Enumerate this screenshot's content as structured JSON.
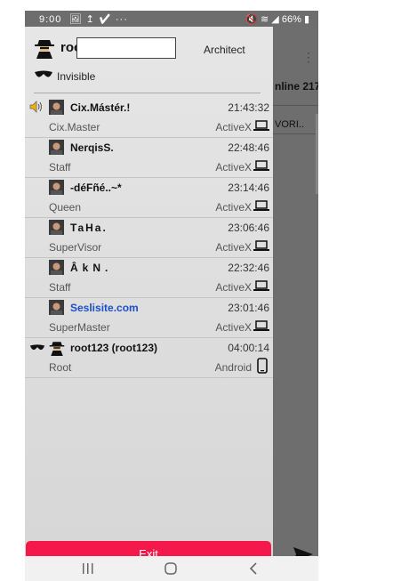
{
  "status_bar": {
    "time": "9:00",
    "left_icons": "🖼 ↥ ✔ ···",
    "right_icons": "🔇 ≋ ◢",
    "battery": "66%"
  },
  "header": {
    "username": "roo",
    "role": "Architect",
    "status_label": "Invisible"
  },
  "users": [
    {
      "nick": "Cix.Mástér.!",
      "time": "21:43:32",
      "role": "Cix.Master",
      "client": "ActiveX",
      "device": "laptop-icon",
      "indicator": "speaker-icon"
    },
    {
      "nick": "NerqisS.",
      "time": "22:48:46",
      "role": "Staff",
      "client": "ActiveX",
      "device": "laptop-icon"
    },
    {
      "nick": "-déFñé..~*",
      "time": "23:14:46",
      "role": "Queen",
      "client": "ActiveX",
      "device": "laptop-icon"
    },
    {
      "nick": "TaHa.",
      "time": "23:06:46",
      "role": "SuperVisor",
      "client": "ActiveX",
      "device": "laptop-icon"
    },
    {
      "nick": "ÂkN.",
      "time": "22:32:46",
      "role": "Staff",
      "client": "ActiveX",
      "device": "laptop-icon"
    },
    {
      "nick": "Seslisite.com",
      "time": "23:01:46",
      "role": "SuperMaster",
      "client": "ActiveX",
      "device": "laptop-icon",
      "nick_color": "#1a4fc8"
    },
    {
      "nick": "root123 (root123)",
      "time": "04:00:14",
      "role": "Root",
      "client": "Android",
      "device": "phone-icon",
      "indicator": "sunglasses-icon"
    }
  ],
  "exit_label": "Exit",
  "background_app": {
    "online_text": "nline 217",
    "fav_text": "VORI.."
  },
  "colors": {
    "exit": "#f5184a",
    "link": "#1a4fc8"
  }
}
